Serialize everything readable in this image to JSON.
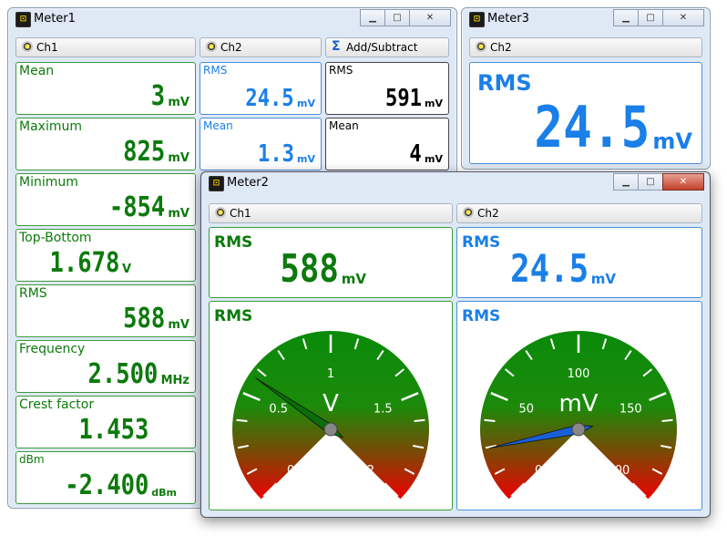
{
  "meter1": {
    "title": "Meter1",
    "tabs": [
      {
        "label": "Ch1",
        "icon": "channel-probe-icon"
      },
      {
        "label": "Ch2",
        "icon": "channel-probe-icon"
      },
      {
        "label": "Add/Subtract",
        "icon": "sigma-icon"
      }
    ],
    "ch1": [
      {
        "label": "Mean",
        "value": "3",
        "unit": "mV"
      },
      {
        "label": "Maximum",
        "value": "825",
        "unit": "mV"
      },
      {
        "label": "Minimum",
        "value": "-854",
        "unit": "mV"
      },
      {
        "label": "Top-Bottom",
        "value": "1.678",
        "unit": "V"
      },
      {
        "label": "RMS",
        "value": "588",
        "unit": "mV"
      },
      {
        "label": "Frequency",
        "value": "2.500",
        "unit": "MHz"
      },
      {
        "label": "Crest factor",
        "value": "1.453",
        "unit": ""
      },
      {
        "label": "dBm",
        "value": "-2.400",
        "unit": "dBm"
      }
    ],
    "ch2": [
      {
        "label": "RMS",
        "value": "24.5",
        "unit": "mV"
      },
      {
        "label": "Mean",
        "value": "1.3",
        "unit": "mV"
      }
    ],
    "addsub": [
      {
        "label": "RMS",
        "value": "591",
        "unit": "mV"
      },
      {
        "label": "Mean",
        "value": "4",
        "unit": "mV"
      }
    ]
  },
  "meter3": {
    "title": "Meter3",
    "tab": {
      "label": "Ch2",
      "icon": "channel-probe-icon"
    },
    "panel": {
      "label": "RMS",
      "value": "24.5",
      "unit": "mV"
    }
  },
  "meter2": {
    "title": "Meter2",
    "tabs": [
      {
        "label": "Ch1",
        "icon": "channel-probe-icon"
      },
      {
        "label": "Ch2",
        "icon": "channel-probe-icon"
      }
    ],
    "digital": [
      {
        "label": "RMS",
        "value": "588",
        "unit": "mV"
      },
      {
        "label": "RMS",
        "value": "24.5",
        "unit": "mV"
      }
    ],
    "gauges": [
      {
        "label": "RMS",
        "unit": "V",
        "ticks": [
          "0",
          "0.5",
          "1",
          "1.5",
          "2"
        ],
        "min": 0,
        "max": 2,
        "reading": 0.588,
        "needle_color": "#0a6e0a"
      },
      {
        "label": "RMS",
        "unit": "mV",
        "ticks": [
          "0",
          "50",
          "100",
          "150",
          "200"
        ],
        "min": 0,
        "max": 200,
        "reading": 24.5,
        "needle_color": "#1a5fd8"
      }
    ]
  },
  "colors": {
    "green": "#0c7a0c",
    "blue": "#1a7fe8",
    "black": "#000000"
  }
}
